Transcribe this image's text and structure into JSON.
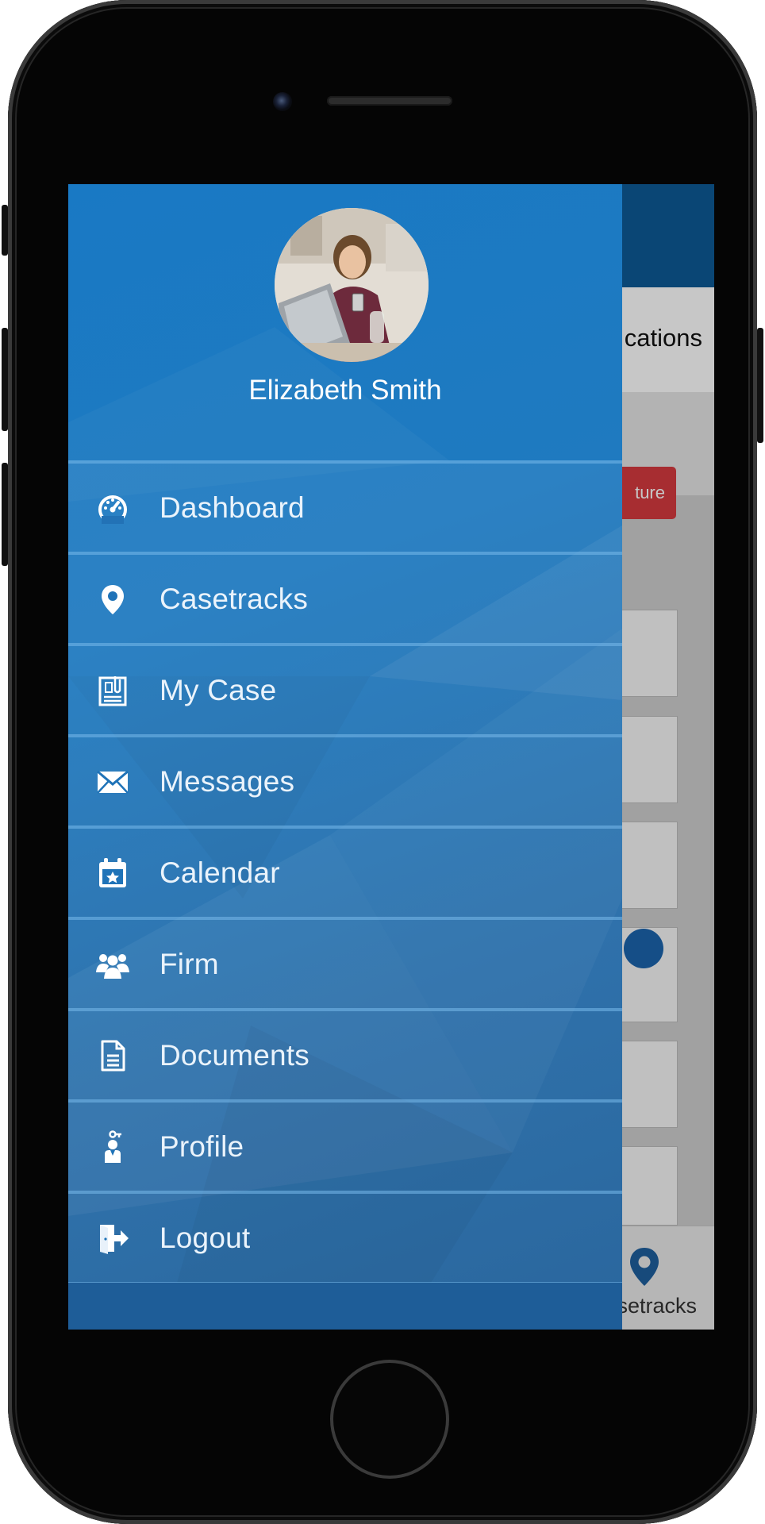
{
  "user": {
    "name": "Elizabeth Smith"
  },
  "menu": {
    "items": [
      {
        "label": "Dashboard",
        "icon": "dashboard-icon"
      },
      {
        "label": "Casetracks",
        "icon": "map-pin-icon"
      },
      {
        "label": "My Case",
        "icon": "clipboard-icon"
      },
      {
        "label": "Messages",
        "icon": "envelope-icon"
      },
      {
        "label": "Calendar",
        "icon": "calendar-star-icon"
      },
      {
        "label": "Firm",
        "icon": "users-icon"
      },
      {
        "label": "Documents",
        "icon": "document-icon"
      },
      {
        "label": "Profile",
        "icon": "profile-icon"
      },
      {
        "label": "Logout",
        "icon": "logout-icon"
      }
    ]
  },
  "background_app": {
    "tab_label": "cations",
    "red_button_label": "ture",
    "bottom_nav_label": "setracks"
  },
  "colors": {
    "drawer_blue": "#1f7ac0",
    "header_blue": "#0d5a96",
    "accent_red": "#d63a3f",
    "text_white": "#ffffff"
  }
}
